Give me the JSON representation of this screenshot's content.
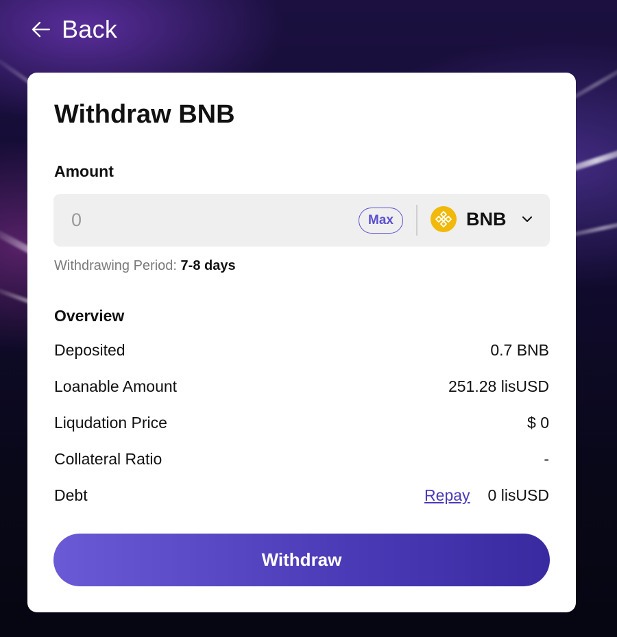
{
  "nav": {
    "back_label": "Back"
  },
  "form": {
    "title": "Withdraw BNB",
    "amount_label": "Amount",
    "amount_placeholder": "0",
    "max_label": "Max",
    "token": "BNB",
    "period_label": "Withdrawing Period:",
    "period_value": "7-8 days"
  },
  "overview": {
    "title": "Overview",
    "rows": [
      {
        "label": "Deposited",
        "value": "0.7 BNB"
      },
      {
        "label": "Loanable Amount",
        "value": "251.28 lisUSD"
      },
      {
        "label": "Liqudation Price",
        "value": "$ 0"
      },
      {
        "label": "Collateral Ratio",
        "value": "-"
      },
      {
        "label": "Debt",
        "value": "0 lisUSD",
        "action": "Repay"
      }
    ]
  },
  "submit_label": "Withdraw",
  "colors": {
    "accent": "#5b4fcf",
    "button_start": "#6a5ad6",
    "button_end": "#3a2aa0",
    "bnb_yellow": "#f0b90b"
  },
  "icons": [
    "arrow-left-icon",
    "bnb-token-icon",
    "chevron-down-icon"
  ]
}
